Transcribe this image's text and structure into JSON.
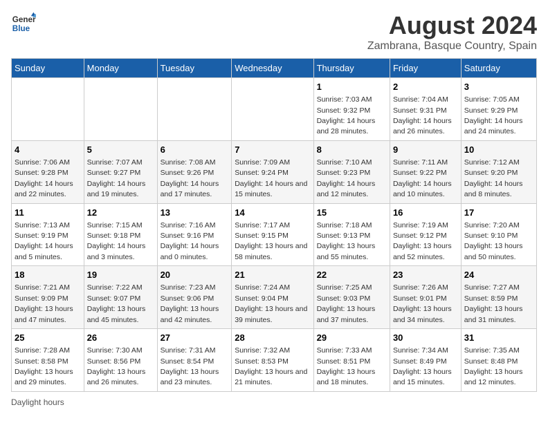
{
  "header": {
    "logo_line1": "General",
    "logo_line2": "Blue",
    "title": "August 2024",
    "subtitle": "Zambrana, Basque Country, Spain"
  },
  "days_of_week": [
    "Sunday",
    "Monday",
    "Tuesday",
    "Wednesday",
    "Thursday",
    "Friday",
    "Saturday"
  ],
  "weeks": [
    [
      {
        "day": "",
        "sunrise": "",
        "sunset": "",
        "daylight": ""
      },
      {
        "day": "",
        "sunrise": "",
        "sunset": "",
        "daylight": ""
      },
      {
        "day": "",
        "sunrise": "",
        "sunset": "",
        "daylight": ""
      },
      {
        "day": "",
        "sunrise": "",
        "sunset": "",
        "daylight": ""
      },
      {
        "day": "1",
        "sunrise": "Sunrise: 7:03 AM",
        "sunset": "Sunset: 9:32 PM",
        "daylight": "Daylight: 14 hours and 28 minutes."
      },
      {
        "day": "2",
        "sunrise": "Sunrise: 7:04 AM",
        "sunset": "Sunset: 9:31 PM",
        "daylight": "Daylight: 14 hours and 26 minutes."
      },
      {
        "day": "3",
        "sunrise": "Sunrise: 7:05 AM",
        "sunset": "Sunset: 9:29 PM",
        "daylight": "Daylight: 14 hours and 24 minutes."
      }
    ],
    [
      {
        "day": "4",
        "sunrise": "Sunrise: 7:06 AM",
        "sunset": "Sunset: 9:28 PM",
        "daylight": "Daylight: 14 hours and 22 minutes."
      },
      {
        "day": "5",
        "sunrise": "Sunrise: 7:07 AM",
        "sunset": "Sunset: 9:27 PM",
        "daylight": "Daylight: 14 hours and 19 minutes."
      },
      {
        "day": "6",
        "sunrise": "Sunrise: 7:08 AM",
        "sunset": "Sunset: 9:26 PM",
        "daylight": "Daylight: 14 hours and 17 minutes."
      },
      {
        "day": "7",
        "sunrise": "Sunrise: 7:09 AM",
        "sunset": "Sunset: 9:24 PM",
        "daylight": "Daylight: 14 hours and 15 minutes."
      },
      {
        "day": "8",
        "sunrise": "Sunrise: 7:10 AM",
        "sunset": "Sunset: 9:23 PM",
        "daylight": "Daylight: 14 hours and 12 minutes."
      },
      {
        "day": "9",
        "sunrise": "Sunrise: 7:11 AM",
        "sunset": "Sunset: 9:22 PM",
        "daylight": "Daylight: 14 hours and 10 minutes."
      },
      {
        "day": "10",
        "sunrise": "Sunrise: 7:12 AM",
        "sunset": "Sunset: 9:20 PM",
        "daylight": "Daylight: 14 hours and 8 minutes."
      }
    ],
    [
      {
        "day": "11",
        "sunrise": "Sunrise: 7:13 AM",
        "sunset": "Sunset: 9:19 PM",
        "daylight": "Daylight: 14 hours and 5 minutes."
      },
      {
        "day": "12",
        "sunrise": "Sunrise: 7:15 AM",
        "sunset": "Sunset: 9:18 PM",
        "daylight": "Daylight: 14 hours and 3 minutes."
      },
      {
        "day": "13",
        "sunrise": "Sunrise: 7:16 AM",
        "sunset": "Sunset: 9:16 PM",
        "daylight": "Daylight: 14 hours and 0 minutes."
      },
      {
        "day": "14",
        "sunrise": "Sunrise: 7:17 AM",
        "sunset": "Sunset: 9:15 PM",
        "daylight": "Daylight: 13 hours and 58 minutes."
      },
      {
        "day": "15",
        "sunrise": "Sunrise: 7:18 AM",
        "sunset": "Sunset: 9:13 PM",
        "daylight": "Daylight: 13 hours and 55 minutes."
      },
      {
        "day": "16",
        "sunrise": "Sunrise: 7:19 AM",
        "sunset": "Sunset: 9:12 PM",
        "daylight": "Daylight: 13 hours and 52 minutes."
      },
      {
        "day": "17",
        "sunrise": "Sunrise: 7:20 AM",
        "sunset": "Sunset: 9:10 PM",
        "daylight": "Daylight: 13 hours and 50 minutes."
      }
    ],
    [
      {
        "day": "18",
        "sunrise": "Sunrise: 7:21 AM",
        "sunset": "Sunset: 9:09 PM",
        "daylight": "Daylight: 13 hours and 47 minutes."
      },
      {
        "day": "19",
        "sunrise": "Sunrise: 7:22 AM",
        "sunset": "Sunset: 9:07 PM",
        "daylight": "Daylight: 13 hours and 45 minutes."
      },
      {
        "day": "20",
        "sunrise": "Sunrise: 7:23 AM",
        "sunset": "Sunset: 9:06 PM",
        "daylight": "Daylight: 13 hours and 42 minutes."
      },
      {
        "day": "21",
        "sunrise": "Sunrise: 7:24 AM",
        "sunset": "Sunset: 9:04 PM",
        "daylight": "Daylight: 13 hours and 39 minutes."
      },
      {
        "day": "22",
        "sunrise": "Sunrise: 7:25 AM",
        "sunset": "Sunset: 9:03 PM",
        "daylight": "Daylight: 13 hours and 37 minutes."
      },
      {
        "day": "23",
        "sunrise": "Sunrise: 7:26 AM",
        "sunset": "Sunset: 9:01 PM",
        "daylight": "Daylight: 13 hours and 34 minutes."
      },
      {
        "day": "24",
        "sunrise": "Sunrise: 7:27 AM",
        "sunset": "Sunset: 8:59 PM",
        "daylight": "Daylight: 13 hours and 31 minutes."
      }
    ],
    [
      {
        "day": "25",
        "sunrise": "Sunrise: 7:28 AM",
        "sunset": "Sunset: 8:58 PM",
        "daylight": "Daylight: 13 hours and 29 minutes."
      },
      {
        "day": "26",
        "sunrise": "Sunrise: 7:30 AM",
        "sunset": "Sunset: 8:56 PM",
        "daylight": "Daylight: 13 hours and 26 minutes."
      },
      {
        "day": "27",
        "sunrise": "Sunrise: 7:31 AM",
        "sunset": "Sunset: 8:54 PM",
        "daylight": "Daylight: 13 hours and 23 minutes."
      },
      {
        "day": "28",
        "sunrise": "Sunrise: 7:32 AM",
        "sunset": "Sunset: 8:53 PM",
        "daylight": "Daylight: 13 hours and 21 minutes."
      },
      {
        "day": "29",
        "sunrise": "Sunrise: 7:33 AM",
        "sunset": "Sunset: 8:51 PM",
        "daylight": "Daylight: 13 hours and 18 minutes."
      },
      {
        "day": "30",
        "sunrise": "Sunrise: 7:34 AM",
        "sunset": "Sunset: 8:49 PM",
        "daylight": "Daylight: 13 hours and 15 minutes."
      },
      {
        "day": "31",
        "sunrise": "Sunrise: 7:35 AM",
        "sunset": "Sunset: 8:48 PM",
        "daylight": "Daylight: 13 hours and 12 minutes."
      }
    ]
  ],
  "footer": {
    "note": "Daylight hours"
  }
}
